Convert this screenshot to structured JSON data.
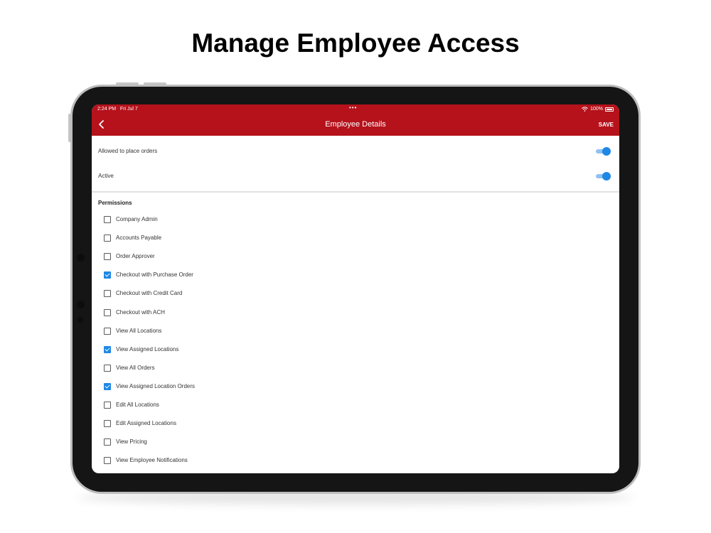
{
  "headline": "Manage Employee Access",
  "status_bar": {
    "time": "2:24 PM",
    "date": "Fri Jul 7",
    "battery": "100%"
  },
  "header": {
    "title": "Employee Details",
    "save_label": "SAVE",
    "color": "#b5121b"
  },
  "toggles": [
    {
      "label": "Allowed to place orders",
      "on": true
    },
    {
      "label": "Active",
      "on": true
    }
  ],
  "permissions": {
    "heading": "Permissions",
    "items": [
      {
        "label": "Company Admin",
        "checked": false
      },
      {
        "label": "Accounts Payable",
        "checked": false
      },
      {
        "label": "Order Approver",
        "checked": false
      },
      {
        "label": "Checkout with Purchase Order",
        "checked": true
      },
      {
        "label": "Checkout with Credit Card",
        "checked": false
      },
      {
        "label": "Checkout with ACH",
        "checked": false
      },
      {
        "label": "View All Locations",
        "checked": false
      },
      {
        "label": "View Assigned Locations",
        "checked": true
      },
      {
        "label": "View All Orders",
        "checked": false
      },
      {
        "label": "View Assigned Location Orders",
        "checked": true
      },
      {
        "label": "Edit All Locations",
        "checked": false
      },
      {
        "label": "Edit Assigned Locations",
        "checked": false
      },
      {
        "label": "View Pricing",
        "checked": false
      },
      {
        "label": "View Employee Notifications",
        "checked": false
      }
    ]
  },
  "accent_color": "#1e88e5"
}
